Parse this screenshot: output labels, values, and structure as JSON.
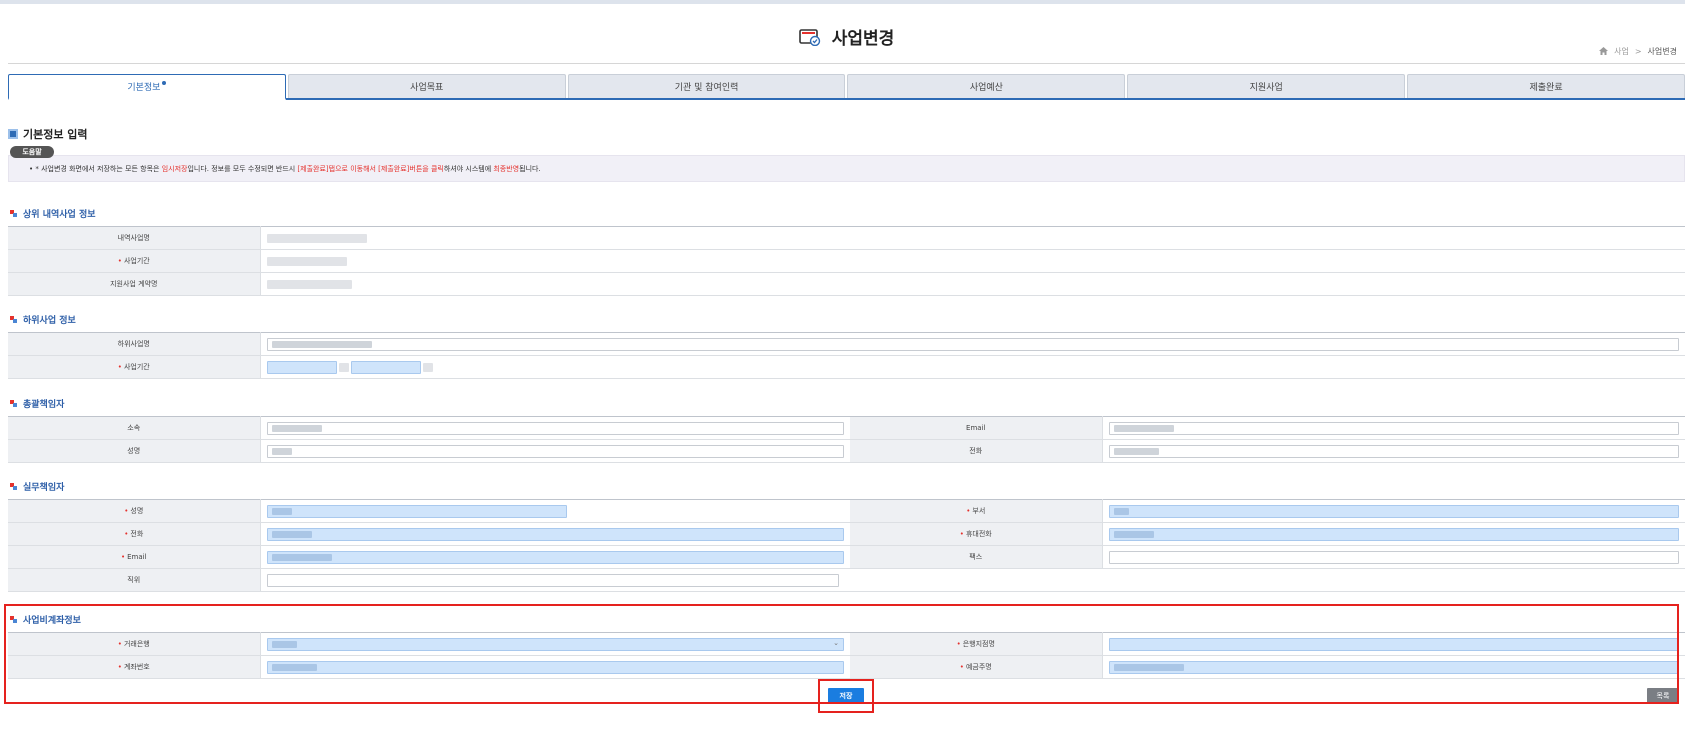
{
  "header": {
    "title": "사업변경",
    "breadcrumb": {
      "home_icon": "home-icon",
      "level1": "사업",
      "separator": ">",
      "level2": "사업변경"
    }
  },
  "tabs": [
    {
      "label": "기본정보",
      "active": true
    },
    {
      "label": "사업목표",
      "active": false
    },
    {
      "label": "기관 및 참여인력",
      "active": false
    },
    {
      "label": "사업예산",
      "active": false
    },
    {
      "label": "지원사업",
      "active": false
    },
    {
      "label": "제출완료",
      "active": false
    }
  ],
  "main": {
    "section_title": "기본정보 입력",
    "help_label": "도움말",
    "notice": {
      "part1": "* 사업변경 화면에서 저장하는 모든 항목은 ",
      "red1": "임시저장",
      "part2": "입니다. 정보를 모두 수정되면 반드시 ",
      "red2": "[제출완료]탭으로 이동해서 [제출완료]버튼을 클릭",
      "part3": "하셔야 시스템에 ",
      "red3": "최종반영",
      "part4": "됩니다."
    }
  },
  "upper": {
    "title": "상위 내역사업 정보",
    "row1_label": "내역사업명",
    "row2_label": "사업기간",
    "row3_label": "지원사업 계약명"
  },
  "lower": {
    "title": "하위사업 정보",
    "row1_label": "하위사업명",
    "row2_label": "사업기간"
  },
  "general": {
    "title": "총괄책임자",
    "affiliation_label": "소속",
    "email_label": "Email",
    "name_label": "성명",
    "phone_label": "전화"
  },
  "practical": {
    "title": "실무책임자",
    "name_label": "성명",
    "dept_label": "부서",
    "phone_label": "전화",
    "mobile_label": "휴대전화",
    "email_label": "Email",
    "fax_label": "팩스",
    "position_label": "직위"
  },
  "account": {
    "title": "사업비계좌정보",
    "bank_label": "거래은행",
    "branch_label": "은행지점명",
    "account_label": "계좌번호",
    "holder_label": "예금주명"
  },
  "actions": {
    "save_label": "저장",
    "list_label": "목록"
  }
}
